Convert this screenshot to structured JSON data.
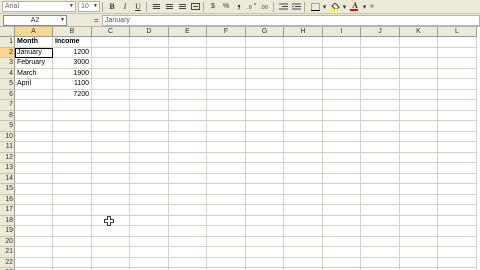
{
  "toolbar": {
    "font_name": "Arial",
    "font_size": "10",
    "bold_label": "B",
    "italic_label": "I",
    "underline_label": "U",
    "currency_label": "$",
    "percent_label": "%",
    "fill_color": "#ffff00",
    "font_color": "#ff0000"
  },
  "formula_bar": {
    "name_box": "A2",
    "equals": "=",
    "content": "January"
  },
  "columns": [
    "A",
    "B",
    "C",
    "D",
    "E",
    "F",
    "G",
    "H",
    "I",
    "J",
    "K",
    "L"
  ],
  "rows": [
    "1",
    "2",
    "3",
    "4",
    "5",
    "6",
    "7",
    "8",
    "9",
    "10",
    "11",
    "12",
    "13",
    "14",
    "15",
    "16",
    "17",
    "18",
    "19",
    "20",
    "21",
    "22",
    "23"
  ],
  "active_cell": {
    "column": "A",
    "row": "2"
  },
  "cells": {
    "A1": "Month",
    "B1": "Income",
    "A2": "January",
    "B2": "1200",
    "A3": "February",
    "B3": "3000",
    "A4": "March",
    "B4": "1900",
    "A5": "April",
    "B5": "1100",
    "B6": "7200"
  }
}
